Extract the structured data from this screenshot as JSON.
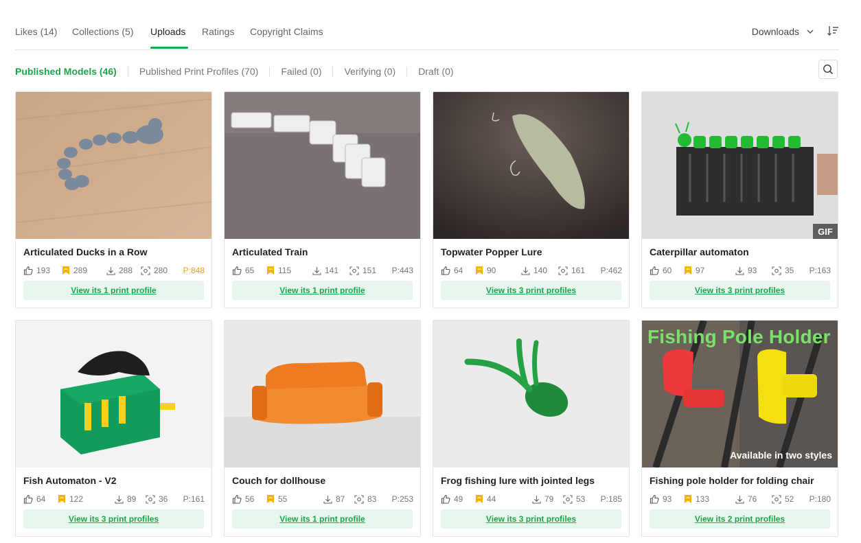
{
  "tabs": [
    {
      "label": "Likes (14)"
    },
    {
      "label": "Collections (5)"
    },
    {
      "label": "Uploads",
      "active": true
    },
    {
      "label": "Ratings"
    },
    {
      "label": "Copyright Claims"
    }
  ],
  "sort": {
    "label": "Downloads",
    "icon": "chevron-down-icon",
    "order_icon": "sort-descending-icon"
  },
  "subtabs": [
    {
      "label": "Published Models (46)",
      "active": true
    },
    {
      "label": "Published Print Profiles (70)"
    },
    {
      "label": "Failed (0)"
    },
    {
      "label": "Verifying (0)"
    },
    {
      "label": "Draft (0)"
    }
  ],
  "search": {
    "icon": "search-icon"
  },
  "colors": {
    "accent": "#1aa64a",
    "accent_bg": "#e9f6ee",
    "hot": "#f0a500",
    "collect": "#f5b400"
  },
  "models": [
    {
      "title": "Articulated Ducks in a Row",
      "likes": "193",
      "collects": "289",
      "downloads": "288",
      "prints": "280",
      "popularity": "P:848",
      "hot": true,
      "profiles_label": "View its 1 print profile",
      "gif": ""
    },
    {
      "title": "Articulated Train",
      "likes": "65",
      "collects": "115",
      "downloads": "141",
      "prints": "151",
      "popularity": "P:443",
      "hot": false,
      "profiles_label": "View its 1 print profile",
      "gif": ""
    },
    {
      "title": "Topwater Popper Lure",
      "likes": "64",
      "collects": "90",
      "downloads": "140",
      "prints": "161",
      "popularity": "P:462",
      "hot": false,
      "profiles_label": "View its 3 print profiles",
      "gif": ""
    },
    {
      "title": "Caterpillar automaton",
      "likes": "60",
      "collects": "97",
      "downloads": "93",
      "prints": "35",
      "popularity": "P:163",
      "hot": false,
      "profiles_label": "View its 3 print profiles",
      "gif": "GIF"
    },
    {
      "title": "Fish Automaton - V2",
      "likes": "64",
      "collects": "122",
      "downloads": "89",
      "prints": "36",
      "popularity": "P:161",
      "hot": false,
      "profiles_label": "View its 3 print profiles",
      "gif": ""
    },
    {
      "title": "Couch for dollhouse",
      "likes": "56",
      "collects": "55",
      "downloads": "87",
      "prints": "83",
      "popularity": "P:253",
      "hot": false,
      "profiles_label": "View its 1 print profile",
      "gif": ""
    },
    {
      "title": "Frog fishing lure with jointed legs",
      "likes": "49",
      "collects": "44",
      "downloads": "79",
      "prints": "53",
      "popularity": "P:185",
      "hot": false,
      "profiles_label": "View its 3 print profiles",
      "gif": ""
    },
    {
      "title": "Fishing pole holder for folding chair",
      "likes": "93",
      "collects": "133",
      "downloads": "76",
      "prints": "52",
      "popularity": "P:180",
      "hot": false,
      "profiles_label": "View its 2 print profiles",
      "gif": "",
      "overlay_title": "Fishing Pole Holder",
      "overlay_caption": "Available in two styles"
    }
  ]
}
